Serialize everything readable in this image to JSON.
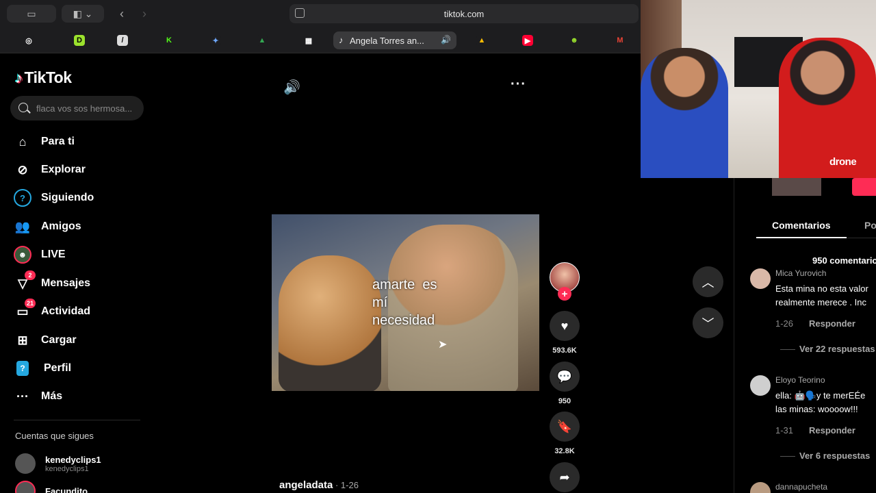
{
  "browser": {
    "url": "tiktok.com",
    "active_tab_title": "Angela Torres an...",
    "back_icon": "chevron-left-icon",
    "forward_icon": "chevron-right-icon"
  },
  "favicons": [
    {
      "name": "openai-favicon",
      "glyph": "◎",
      "color": "#ffffff",
      "bg": "#1d1d1f"
    },
    {
      "name": "d-favicon",
      "glyph": "D",
      "color": "#000000",
      "bg": "#9be22d"
    },
    {
      "name": "slash-favicon",
      "glyph": "/",
      "color": "#000000",
      "bg": "#dddddd"
    },
    {
      "name": "kick-favicon",
      "glyph": "K",
      "color": "#53fc18",
      "bg": "#1d1d1f"
    },
    {
      "name": "gemini-favicon",
      "glyph": "✦",
      "color": "#6fa8ff",
      "bg": "#1d1d1f"
    },
    {
      "name": "drive-favicon",
      "glyph": "▲",
      "color": "#34a853",
      "bg": "#1d1d1f"
    },
    {
      "name": "sheet-favicon",
      "glyph": "▦",
      "color": "#ffffff",
      "bg": "#1d1d1f"
    },
    {
      "name": "drive-favicon-2",
      "glyph": "▲",
      "color": "#fbbc04",
      "bg": "#1d1d1f"
    },
    {
      "name": "youtube-favicon",
      "glyph": "▶",
      "color": "#ffffff",
      "bg": "#ff0033"
    },
    {
      "name": "game-favicon",
      "glyph": "☻",
      "color": "#9be22d",
      "bg": "#1d1d1f"
    },
    {
      "name": "gmail-favicon",
      "glyph": "M",
      "color": "#ea4335",
      "bg": "#1d1d1f"
    }
  ],
  "sidebar": {
    "logo": "TikTok",
    "search_placeholder": "flaca vos sos hermosa...",
    "items": [
      {
        "label": "Para ti",
        "icon": "home-icon"
      },
      {
        "label": "Explorar",
        "icon": "compass-icon"
      },
      {
        "label": "Siguiendo",
        "icon": "following-icon"
      },
      {
        "label": "Amigos",
        "icon": "friends-icon"
      },
      {
        "label": "LIVE",
        "icon": "live-icon"
      },
      {
        "label": "Mensajes",
        "icon": "messages-icon",
        "badge": "2"
      },
      {
        "label": "Actividad",
        "icon": "activity-icon",
        "badge": "21"
      },
      {
        "label": "Cargar",
        "icon": "upload-icon"
      },
      {
        "label": "Perfil",
        "icon": "profile-icon"
      },
      {
        "label": "Más",
        "icon": "more-icon"
      }
    ],
    "following_title": "Cuentas que sigues",
    "accounts": [
      {
        "name": "kenedyclips1",
        "handle": "kenedyclips1"
      },
      {
        "name": "Facundito",
        "handle": ""
      }
    ]
  },
  "video": {
    "caption_lines": [
      "amarte  es",
      "mí",
      "necesidad"
    ],
    "author": "angeladata",
    "date": " · 1-26",
    "likes": "593.6K",
    "comments": "950",
    "saves": "32.8K"
  },
  "comments_panel": {
    "tab_comments": "Comentarios",
    "tab_other": "Po",
    "count_label": "950 comentarios",
    "comments": [
      {
        "user": "Mica Yurovich",
        "text_lines": [
          "Esta mina no esta valor",
          "realmente merece . Inc"
        ],
        "date": "1-26",
        "reply": "Responder",
        "view_replies": "Ver 22 respuestas"
      },
      {
        "user": "Eloyo Teorino",
        "text_lines": [
          "ella: 🤖🗣️y te merEÉe",
          "las minas: woooow!!!"
        ],
        "date": "1-31",
        "reply": "Responder",
        "view_replies": "Ver 6 respuestas"
      },
      {
        "user": "dannapucheta",
        "text_lines": [],
        "date": "",
        "reply": "",
        "view_replies": ""
      }
    ]
  },
  "webcam": {
    "shirt_text": "drone"
  },
  "colors": {
    "accent": "#fe2c55",
    "background": "#000000"
  }
}
